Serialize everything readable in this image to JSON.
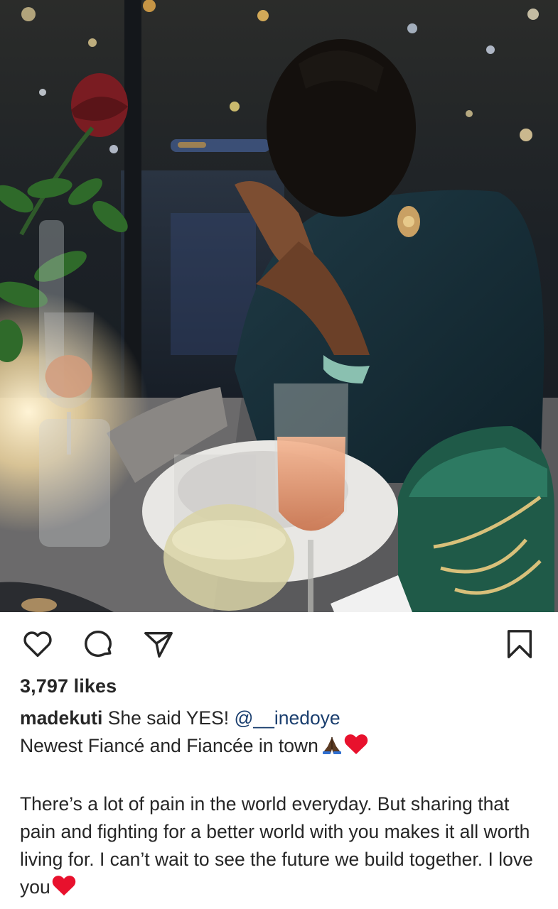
{
  "photo": {
    "alt": "Post photo"
  },
  "actions": {
    "like_icon": "heart-outline-icon",
    "comment_icon": "comment-bubble-icon",
    "share_icon": "paper-plane-icon",
    "save_icon": "bookmark-outline-icon"
  },
  "likes": {
    "text": "3,797 likes"
  },
  "caption": {
    "username": "madekuti",
    "line1_text": " She said YES! ",
    "mention": "@__inedoye",
    "line2_text": "Newest Fiancé and Fiancée in town",
    "line2_emojis": [
      "praying-hands-icon",
      "red-heart-icon"
    ],
    "body_text": "There’s a lot of pain in the world everyday. But sharing that pain and fighting for a better world with you makes it all worth living for. I can’t wait to see the future we build together. I love you",
    "body_emoji": "red-heart-icon"
  },
  "colors": {
    "text": "#262626",
    "mention": "#1a3e6e",
    "heart": "#e8112d",
    "muted": "#8e8e8e"
  }
}
